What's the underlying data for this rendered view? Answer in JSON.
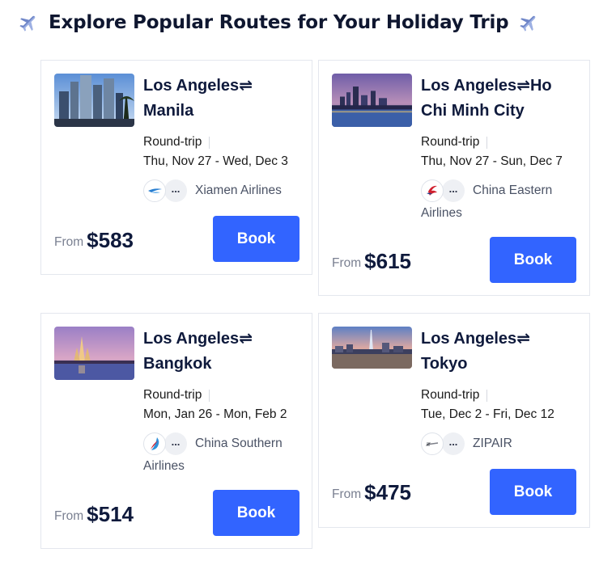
{
  "header": {
    "title": "Explore Popular Routes for Your Holiday Trip",
    "left_icon": "airplane-icon",
    "right_icon": "airplane-icon"
  },
  "cards": [
    {
      "route_from": "Los Angeles",
      "route_arrow": "⇌",
      "route_to": "Manila",
      "trip_type": "Round-trip",
      "dates": "Thu, Nov 27 - Wed, Dec 3",
      "more": "...",
      "airline": "Xiamen Airlines",
      "from_label": "From",
      "price": "$583",
      "book_label": "Book",
      "image": "manila-skyline-photo"
    },
    {
      "route_from": "Los Angeles",
      "route_arrow": "⇌",
      "route_to": "Ho Chi Minh City",
      "trip_type": "Round-trip",
      "dates": "Thu, Nov 27 - Sun, Dec 7",
      "more": "...",
      "airline": "China Eastern Airlines",
      "from_label": "From",
      "price": "$615",
      "book_label": "Book",
      "image": "ho-chi-minh-city-photo"
    },
    {
      "route_from": "Los Angeles",
      "route_arrow": "⇌",
      "route_to": "Bangkok",
      "trip_type": "Round-trip",
      "dates": "Mon, Jan 26 - Mon, Feb 2",
      "more": "...",
      "airline": "China Southern Airlines",
      "from_label": "From",
      "price": "$514",
      "book_label": "Book",
      "image": "bangkok-temple-photo"
    },
    {
      "route_from": "Los Angeles",
      "route_arrow": "⇌",
      "route_to": "Tokyo",
      "trip_type": "Round-trip",
      "dates": "Tue, Dec 2 - Fri, Dec 12",
      "more": "...",
      "airline": "ZIPAIR",
      "from_label": "From",
      "price": "$475",
      "book_label": "Book",
      "image": "tokyo-skyline-photo"
    }
  ],
  "colors": {
    "accent": "#3264ff",
    "title": "#0f1a3c",
    "muted": "#7a8091",
    "border": "#e4e7ee"
  }
}
